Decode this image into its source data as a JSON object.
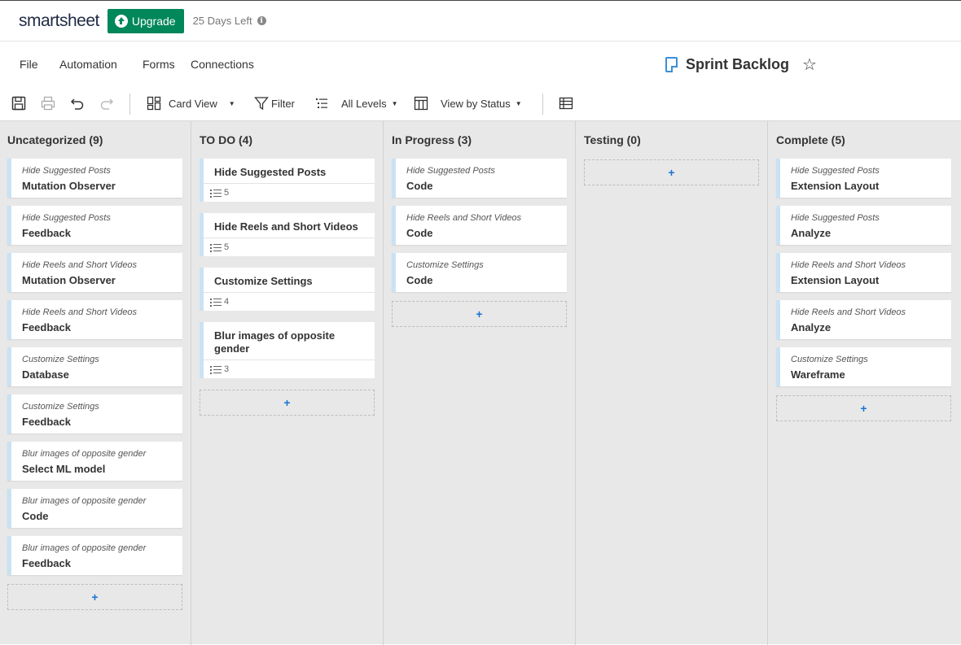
{
  "app": {
    "logo": "smartsheet",
    "upgrade_label": "Upgrade",
    "days_left": "25 Days Left"
  },
  "menu": {
    "file": "File",
    "automation": "Automation",
    "forms": "Forms",
    "connections": "Connections"
  },
  "sheet": {
    "title": "Sprint Backlog"
  },
  "toolbar": {
    "view": "Card View",
    "filter": "Filter",
    "levels": "All Levels",
    "view_by": "View by Status"
  },
  "board": {
    "add_symbol": "+",
    "columns": [
      {
        "title": "Uncategorized (9)",
        "cards": [
          {
            "sub": "Hide Suggested Posts",
            "main": "Mutation Observer"
          },
          {
            "sub": "Hide Suggested Posts",
            "main": "Feedback"
          },
          {
            "sub": "Hide Reels and Short Videos",
            "main": "Mutation Observer"
          },
          {
            "sub": "Hide Reels and Short Videos",
            "main": "Feedback"
          },
          {
            "sub": "Customize Settings",
            "main": "Database"
          },
          {
            "sub": "Customize Settings",
            "main": "Feedback"
          },
          {
            "sub": "Blur images of opposite gender",
            "main": "Select ML model"
          },
          {
            "sub": "Blur images of opposite gender",
            "main": "Code"
          },
          {
            "sub": "Blur images of opposite gender",
            "main": "Feedback"
          }
        ]
      },
      {
        "title": "TO DO (4)",
        "cards": [
          {
            "title": "Hide Suggested Posts",
            "count": "5"
          },
          {
            "title": "Hide Reels and Short Videos",
            "count": "5"
          },
          {
            "title": "Customize Settings",
            "count": "4"
          },
          {
            "title": "Blur images of opposite gender",
            "count": "3"
          }
        ]
      },
      {
        "title": "In Progress (3)",
        "cards": [
          {
            "sub": "Hide Suggested Posts",
            "main": "Code"
          },
          {
            "sub": "Hide Reels and Short Videos",
            "main": "Code"
          },
          {
            "sub": "Customize Settings",
            "main": "Code"
          }
        ]
      },
      {
        "title": "Testing (0)",
        "cards": []
      },
      {
        "title": "Complete (5)",
        "cards": [
          {
            "sub": "Hide Suggested Posts",
            "main": "Extension Layout"
          },
          {
            "sub": "Hide Suggested Posts",
            "main": "Analyze"
          },
          {
            "sub": "Hide Reels and Short Videos",
            "main": "Extension Layout"
          },
          {
            "sub": "Hide Reels and Short Videos",
            "main": "Analyze"
          },
          {
            "sub": "Customize Settings",
            "main": "Wareframe"
          }
        ]
      }
    ]
  }
}
